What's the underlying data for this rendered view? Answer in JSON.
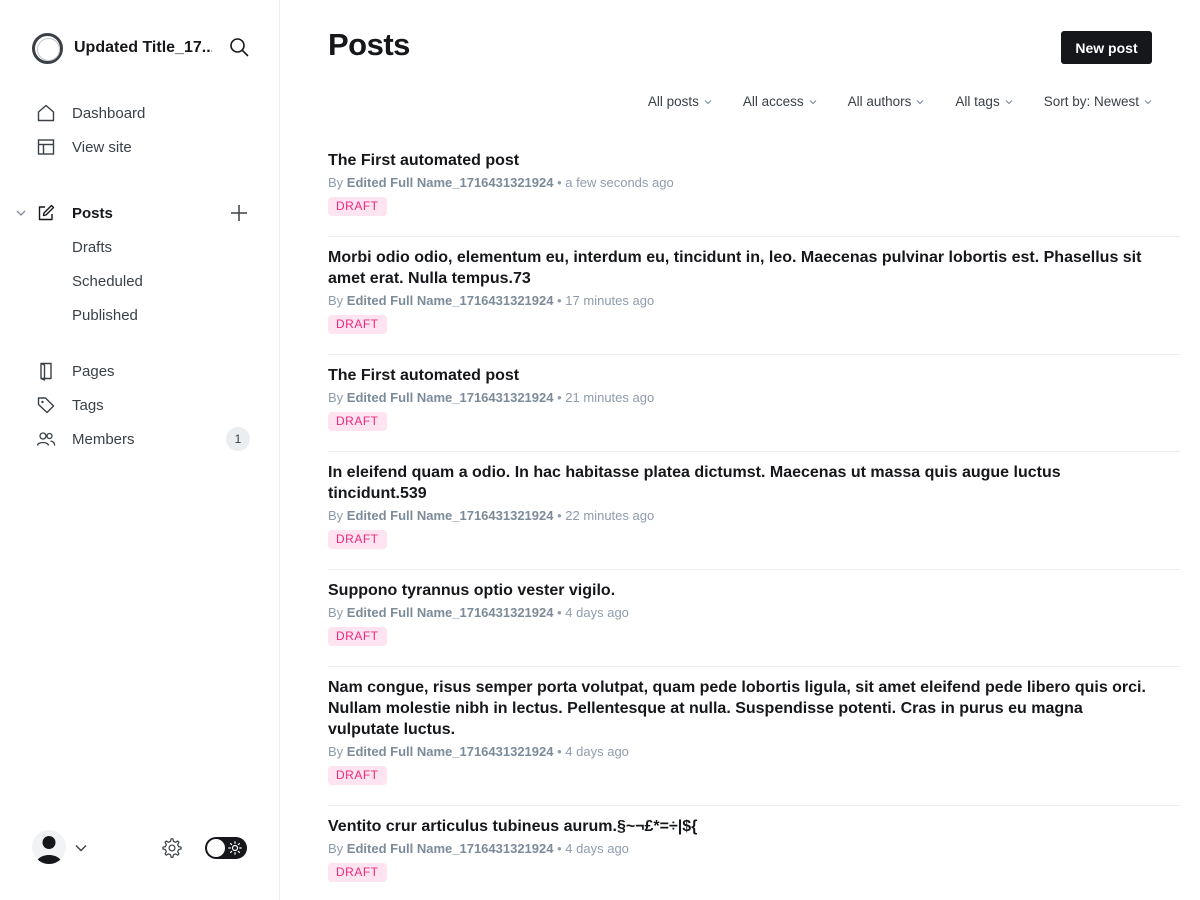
{
  "site": {
    "title": "Updated Title_17..."
  },
  "nav": {
    "dashboard": "Dashboard",
    "view_site": "View site",
    "posts": "Posts",
    "drafts": "Drafts",
    "scheduled": "Scheduled",
    "published": "Published",
    "pages": "Pages",
    "tags": "Tags",
    "members": "Members",
    "members_count": "1"
  },
  "header": {
    "title": "Posts",
    "new_post": "New post"
  },
  "filters": [
    {
      "label": "All posts"
    },
    {
      "label": "All access"
    },
    {
      "label": "All authors"
    },
    {
      "label": "All tags"
    },
    {
      "label": "Sort by: Newest"
    }
  ],
  "posts": [
    {
      "title": "The First automated post",
      "by": "By",
      "author": "Edited Full Name_1716431321924",
      "sep": "•",
      "time": "a few seconds ago",
      "status": "DRAFT"
    },
    {
      "title": "Morbi odio odio, elementum eu, interdum eu, tincidunt in, leo. Maecenas pulvinar lobortis est. Phasellus sit amet erat. Nulla tempus.73",
      "by": "By",
      "author": "Edited Full Name_1716431321924",
      "sep": "•",
      "time": "17 minutes ago",
      "status": "DRAFT"
    },
    {
      "title": "The First automated post",
      "by": "By",
      "author": "Edited Full Name_1716431321924",
      "sep": "•",
      "time": "21 minutes ago",
      "status": "DRAFT"
    },
    {
      "title": "In eleifend quam a odio. In hac habitasse platea dictumst. Maecenas ut massa quis augue luctus tincidunt.539",
      "by": "By",
      "author": "Edited Full Name_1716431321924",
      "sep": "•",
      "time": "22 minutes ago",
      "status": "DRAFT"
    },
    {
      "title": "Suppono tyrannus optio vester vigilo.",
      "by": "By",
      "author": "Edited Full Name_1716431321924",
      "sep": "•",
      "time": "4 days ago",
      "status": "DRAFT"
    },
    {
      "title": "Nam congue, risus semper porta volutpat, quam pede lobortis ligula, sit amet eleifend pede libero quis orci. Nullam molestie nibh in lectus. Pellentesque at nulla. Suspendisse potenti. Cras in purus eu magna vulputate luctus.",
      "by": "By",
      "author": "Edited Full Name_1716431321924",
      "sep": "•",
      "time": "4 days ago",
      "status": "DRAFT"
    },
    {
      "title": "Ventito crur articulus tubineus aurum.§~¬£*=÷|${",
      "by": "By",
      "author": "Edited Full Name_1716431321924",
      "sep": "•",
      "time": "4 days ago",
      "status": "DRAFT"
    }
  ]
}
